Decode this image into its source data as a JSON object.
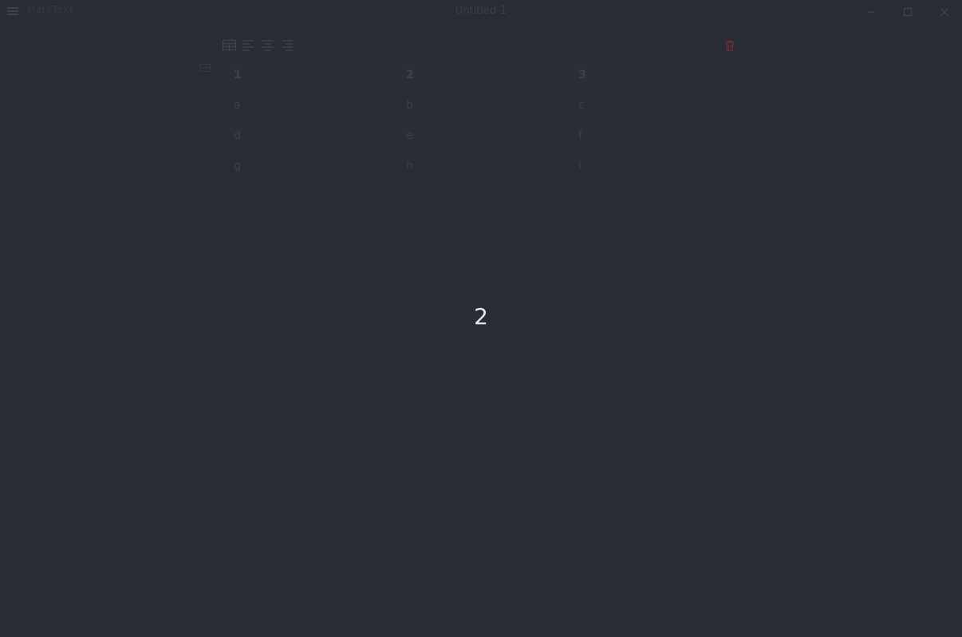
{
  "app": {
    "name": "MarkText",
    "window_title": "Untitled-1"
  },
  "icons": {
    "menu": "hamburger-menu-icon",
    "minimize": "minimize-icon",
    "maximize": "maximize-icon",
    "close": "close-icon",
    "table_resize": "table-grid-icon",
    "align_left": "align-left-icon",
    "align_center": "align-center-icon",
    "align_right": "align-right-icon",
    "delete_table": "trash-icon",
    "drag": "drag-handle-icon"
  },
  "colors": {
    "background": "#282c34",
    "trash": "#6b2e35",
    "overlay_text": "#e6e6e6"
  },
  "table": {
    "headers": [
      "1",
      "2",
      "3"
    ],
    "rows": [
      [
        "a",
        "b",
        "c"
      ],
      [
        "d",
        "e",
        "f"
      ],
      [
        "g",
        "h",
        "i"
      ]
    ]
  },
  "overlay": {
    "count": "2"
  }
}
